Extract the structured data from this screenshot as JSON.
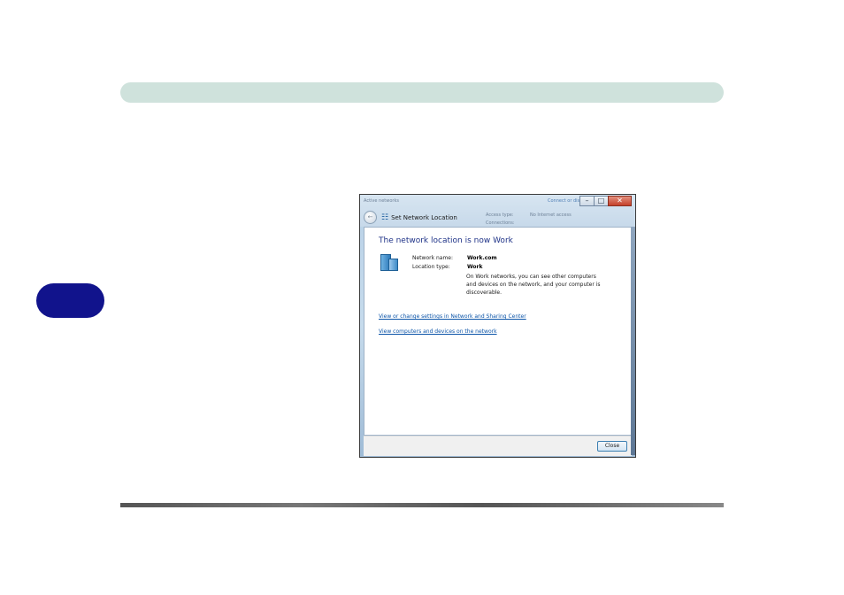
{
  "dialog": {
    "background": {
      "left_text": "Active networks",
      "right_text": "Connect or disconnect",
      "access_type_label": "Access type:",
      "access_type_value": "No Internet access",
      "connections_label": "Connections:"
    },
    "window_title": "Set Network Location",
    "heading": "The network location is now Work",
    "network_name_label": "Network name:",
    "network_name_value": "Work.com",
    "location_type_label": "Location type:",
    "location_type_value": "Work",
    "description": "On Work networks, you can see other computers and devices on the network, and your computer is discoverable.",
    "links": [
      "View or change settings in Network and Sharing Center",
      "View computers and devices on the network"
    ],
    "close_button": "Close",
    "title_buttons": {
      "minimize": "–",
      "maximize": "□",
      "close": "✕"
    }
  },
  "colors": {
    "top_bar": "#cfe2dc",
    "side_tab": "#11138c",
    "heading": "#1e3287",
    "link": "#0b54a8"
  }
}
